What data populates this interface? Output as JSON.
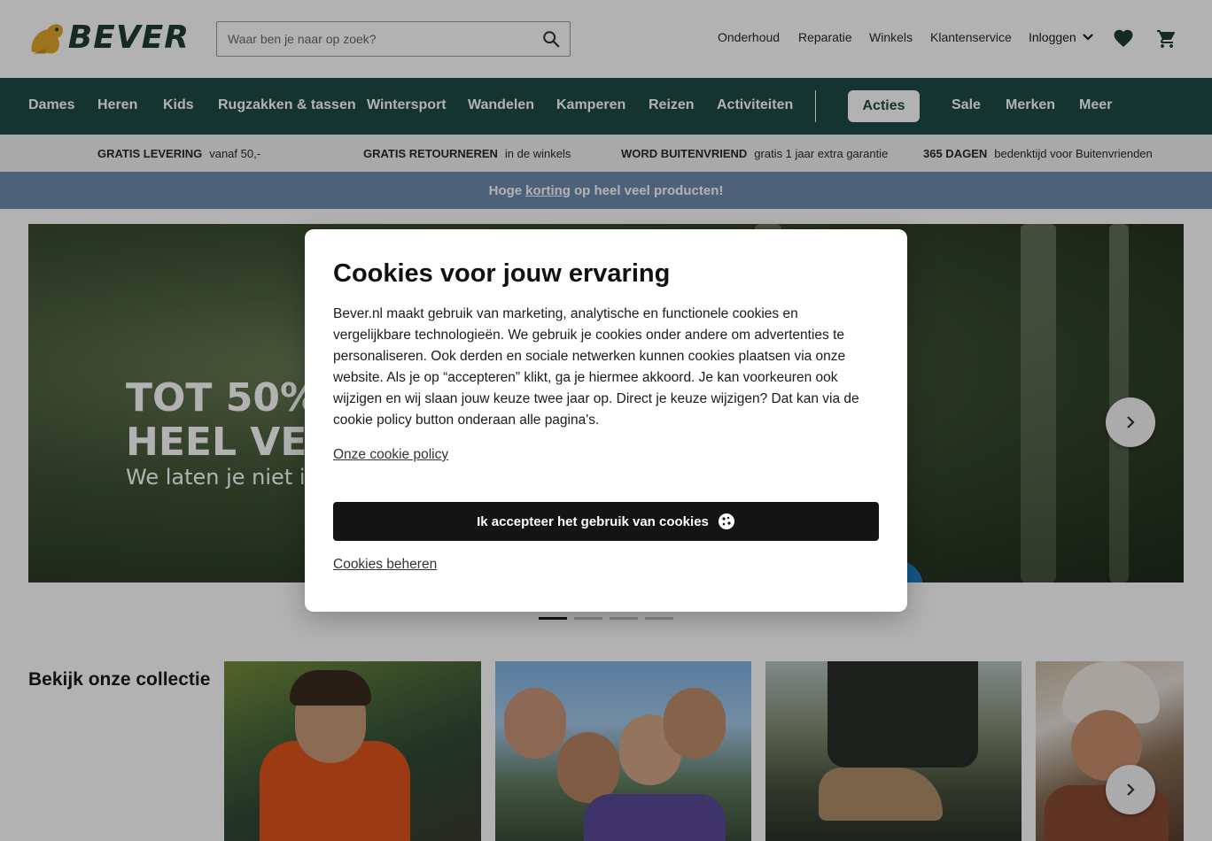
{
  "header": {
    "logo_text": "BEVER",
    "search": {
      "placeholder": "Waar ben je naar op zoek?",
      "value": ""
    },
    "links": [
      "Onderhoud",
      "Reparatie",
      "Winkels",
      "Klantenservice"
    ],
    "login_label": "Inloggen",
    "icons": {
      "search": "search-icon",
      "favorites": "heart-icon",
      "cart": "cart-icon"
    }
  },
  "nav": {
    "items": [
      "Dames",
      "Heren",
      "Kids",
      "Rugzakken & tassen",
      "Wintersport",
      "Wandelen",
      "Kamperen",
      "Reizen",
      "Activiteiten"
    ],
    "acties_label": "Acties",
    "right_items": [
      "Sale",
      "Merken",
      "Meer"
    ]
  },
  "usp": [
    {
      "bold": "GRATIS LEVERING",
      "text": "vanaf 50,-"
    },
    {
      "bold": "GRATIS RETOURNEREN",
      "text": "in de winkels"
    },
    {
      "bold": "WORD BUITENVRIEND",
      "text": "gratis 1 jaar extra garantie"
    },
    {
      "bold": "365 DAGEN",
      "text": "bedenktijd voor Buitenvrienden"
    }
  ],
  "promo": {
    "before": "Hoge",
    "link": "korting",
    "after": "op heel veel producten!"
  },
  "hero": {
    "line1": "TOT 50%",
    "line2": "HEEL VEE",
    "line3": "We laten je niet in",
    "slides_total": 4,
    "active_slide": 1
  },
  "collection": {
    "title": "Bekijk onze collectie"
  },
  "cookie_modal": {
    "title": "Cookies voor jouw ervaring",
    "body": "Bever.nl maakt gebruik van marketing, analytische en functionele cookies en vergelijkbare technologieën. We gebruik je cookies onder andere om advertenties te personaliseren. Ook derden en sociale netwerken kunnen cookies plaatsen via onze website. Als je op “accepteren” klikt, ga je hiermee akkoord. Je kan voorkeuren ook wijzigen en wij slaan jouw keuze twee jaar op. Direct je keuze wijzigen? Dat kan via de cookie policy button onderaan alle pagina's.",
    "policy_link": "Onze cookie policy",
    "accept_label": "Ik accepteer het gebruik van cookies",
    "manage_label": "Cookies beheren"
  },
  "colors": {
    "brand_green": "#1f4a44",
    "promo_blue": "#6f8bb0",
    "logo_gold": "#e0a72a",
    "button_dark": "#141414"
  }
}
